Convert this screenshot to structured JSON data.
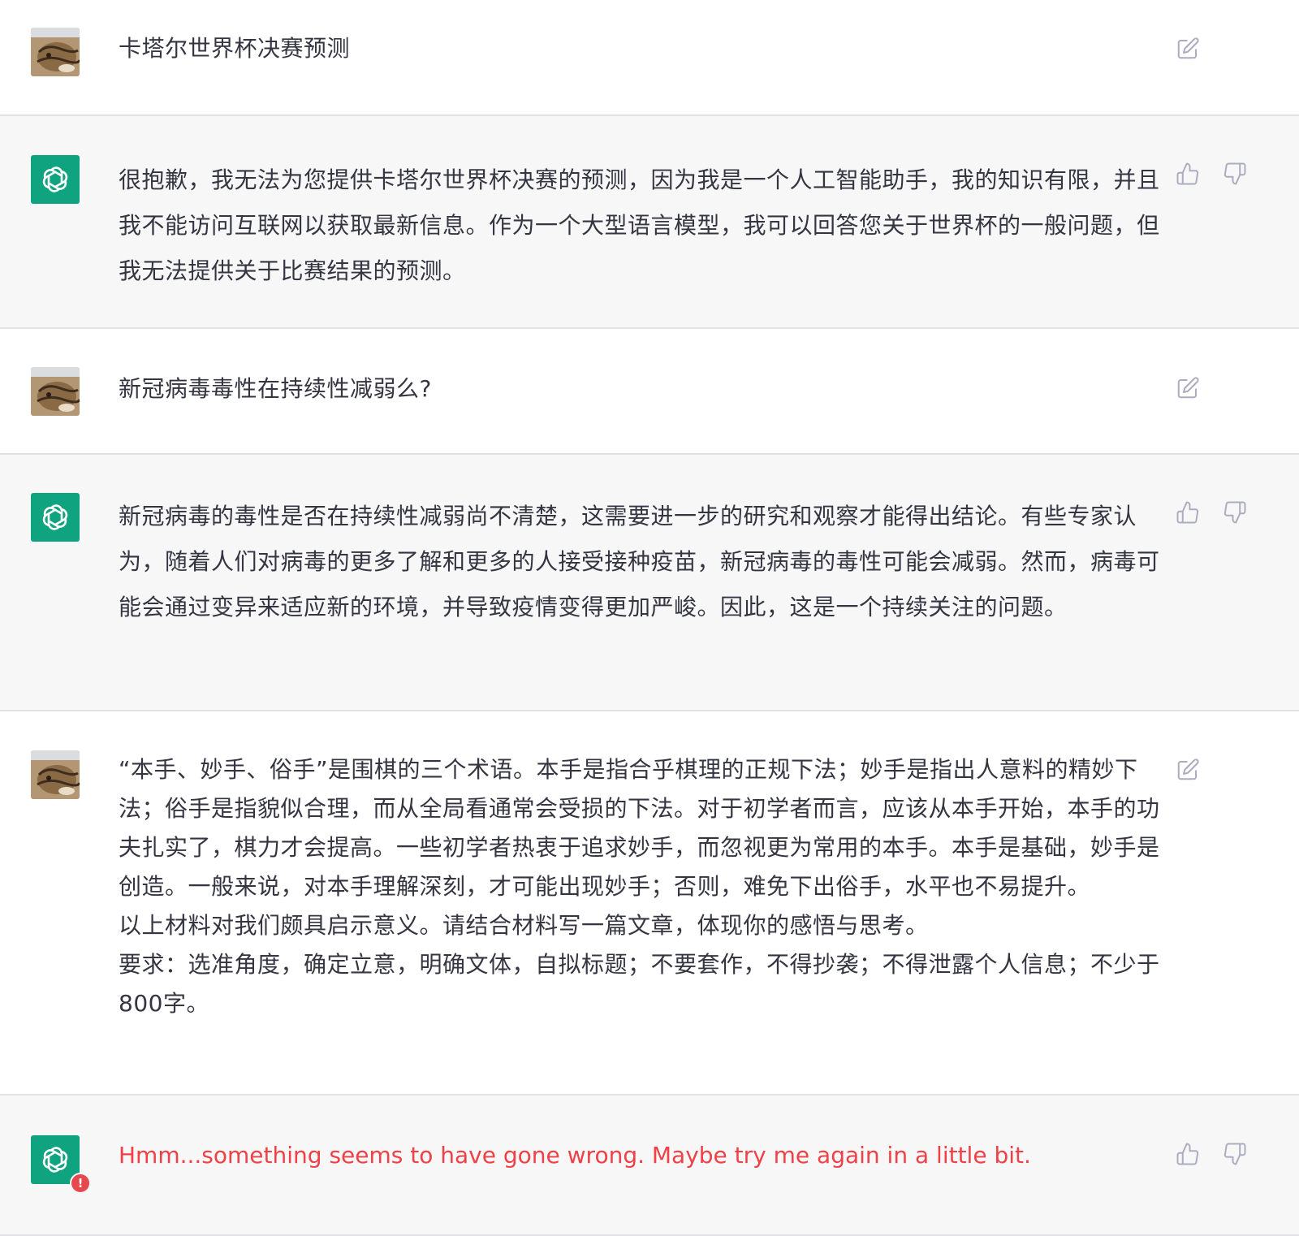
{
  "conversation": {
    "messages": [
      {
        "role": "user",
        "text": "卡塔尔世界杯决赛预测"
      },
      {
        "role": "assistant",
        "text": "很抱歉，我无法为您提供卡塔尔世界杯决赛的预测，因为我是一个人工智能助手，我的知识有限，并且我不能访问互联网以获取最新信息。作为一个大型语言模型，我可以回答您关于世界杯的一般问题，但我无法提供关于比赛结果的预测。"
      },
      {
        "role": "user",
        "text": "新冠病毒毒性在持续性减弱么?"
      },
      {
        "role": "assistant",
        "text": "新冠病毒的毒性是否在持续性减弱尚不清楚，这需要进一步的研究和观察才能得出结论。有些专家认为，随着人们对病毒的更多了解和更多的人接受接种疫苗，新冠病毒的毒性可能会减弱。然而，病毒可能会通过变异来适应新的环境，并导致疫情变得更加严峻。因此，这是一个持续关注的问题。"
      },
      {
        "role": "user",
        "lines": [
          "“本手、妙手、俗手”是围棋的三个术语。本手是指合乎棋理的正规下法；妙手是指出人意料的精妙下法；俗手是指貌似合理，而从全局看通常会受损的下法。对于初学者而言，应该从本手开始，本手的功夫扎实了，棋力才会提高。一些初学者热衷于追求妙手，而忽视更为常用的本手。本手是基础，妙手是创造。一般来说，对本手理解深刻，才可能出现妙手；否则，难免下出俗手，水平也不易提升。",
          "以上材料对我们颇具启示意义。请结合材料写一篇文章，体现你的感悟与思考。",
          "要求：选准角度，确定立意，明确文体，自拟标题；不要套作，不得抄袭；不得泄露个人信息；不少于800字。"
        ]
      },
      {
        "role": "assistant",
        "text": "Hmm...something seems to have gone wrong. Maybe try me again in a little bit.",
        "error": true
      }
    ]
  },
  "icons": {
    "user_avatar": "cat-avatar-icon",
    "assistant_avatar": "openai-logo-icon",
    "edit": "edit-icon",
    "thumbs_up": "thumbs-up-icon",
    "thumbs_down": "thumbs-down-icon",
    "error_badge": "error-badge-icon"
  },
  "colors": {
    "assistant_bg": "#f7f7f8",
    "user_bg": "#ffffff",
    "brand_green": "#10a37f",
    "error_text": "#ef4146",
    "error_badge": "#e5484d"
  },
  "error_badge_symbol": "!"
}
